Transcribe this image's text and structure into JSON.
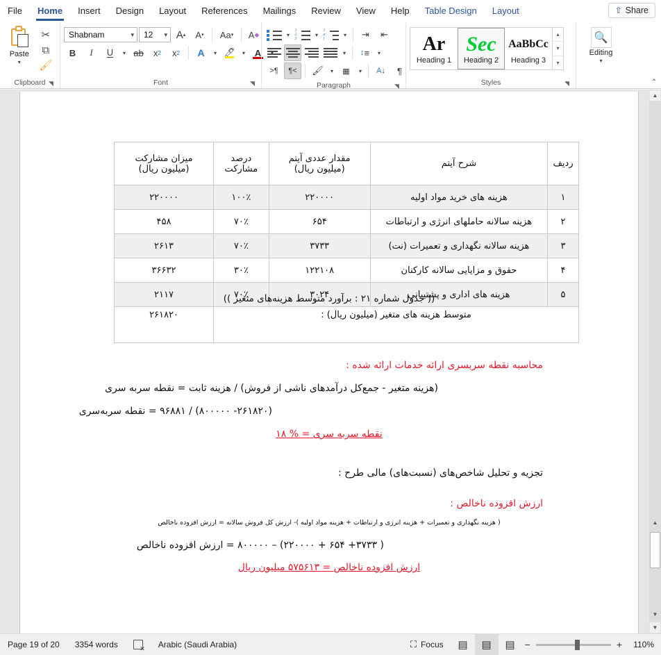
{
  "tabs": [
    {
      "label": "File",
      "state": "normal"
    },
    {
      "label": "Home",
      "state": "active"
    },
    {
      "label": "Insert",
      "state": "normal"
    },
    {
      "label": "Design",
      "state": "normal"
    },
    {
      "label": "Layout",
      "state": "normal"
    },
    {
      "label": "References",
      "state": "normal"
    },
    {
      "label": "Mailings",
      "state": "normal"
    },
    {
      "label": "Review",
      "state": "normal"
    },
    {
      "label": "View",
      "state": "normal"
    },
    {
      "label": "Help",
      "state": "normal"
    },
    {
      "label": "Table Design",
      "state": "contextual"
    },
    {
      "label": "Layout",
      "state": "contextual"
    }
  ],
  "share": {
    "label": "Share",
    "icon": "share-icon"
  },
  "ribbon": {
    "clipboard": {
      "label": "Clipboard",
      "paste_label": "Paste",
      "cut_icon": "scissors-icon",
      "copy_icon": "copy-icon",
      "format_painter_icon": "format-painter-icon"
    },
    "font": {
      "label": "Font",
      "font_name": "Shabnam",
      "font_size": "12",
      "grow_font_icon": "grow-font-icon",
      "shrink_font_icon": "shrink-font-icon",
      "change_case_icon": "change-case-icon",
      "clear_formatting_icon": "clear-formatting-icon",
      "bold": "B",
      "italic": "I",
      "underline": "U",
      "strikethrough_icon": "strikethrough-icon",
      "subscript_icon": "subscript-icon",
      "superscript_icon": "superscript-icon",
      "text_effects_icon": "text-effects-icon",
      "highlight_icon": "text-highlight-icon",
      "font_color_icon": "font-color-icon",
      "font_color_hex": "#cc0000",
      "highlight_hex": "#ffe600"
    },
    "paragraph": {
      "label": "Paragraph",
      "bullets_icon": "bullets-icon",
      "numbering_icon": "numbering-icon",
      "multilevel_icon": "multilevel-list-icon",
      "decrease_indent_icon": "decrease-indent-icon",
      "increase_indent_icon": "increase-indent-icon",
      "align_left_icon": "align-left-icon",
      "align_center_icon": "align-center-icon",
      "align_right_icon": "align-right-icon",
      "justify_icon": "justify-icon",
      "line_spacing_icon": "line-spacing-icon",
      "ltr_icon": "left-to-right-icon",
      "rtl_icon": "right-to-left-icon",
      "shading_icon": "shading-icon",
      "borders_icon": "borders-icon",
      "sort_icon": "sort-icon",
      "show_marks_icon": "show-formatting-marks-icon"
    },
    "styles": {
      "label": "Styles",
      "items": [
        {
          "preview": "Ar",
          "name": "Heading 1",
          "selected": false
        },
        {
          "preview": "Sec",
          "name": "Heading 2",
          "selected": true
        },
        {
          "preview": "AaBbCc",
          "name": "Heading 3",
          "selected": false
        }
      ]
    },
    "editing": {
      "label": "Editing",
      "icon": "search-icon"
    }
  },
  "document": {
    "table": {
      "headers": [
        "ردیف",
        "شرح آیتم",
        "مقدار عددی آیتم\n(میلیون ریال)",
        "درصد\nمشارکت",
        "میزان مشارکت\n(میلیون ریال)"
      ],
      "header_lines": [
        {
          "l1": "ردیف",
          "l2": ""
        },
        {
          "l1": "شرح آیتم",
          "l2": ""
        },
        {
          "l1": "مقدار عددی آیتم",
          "l2": "(میلیون ریال)"
        },
        {
          "l1": "درصد",
          "l2": "مشارکت"
        },
        {
          "l1": "میزان مشارکت",
          "l2": "(میلیون ریال)"
        }
      ],
      "rows": [
        {
          "radif": "۱",
          "desc": "هزینه های خرید مواد اولیه",
          "value": "۲۲۰۰۰۰",
          "percent": "۱۰۰٪",
          "share": "۲۲۰۰۰۰"
        },
        {
          "radif": "۲",
          "desc": "هزینه سالانه حاملهای انرژی و ارتباطات",
          "value": "۶۵۴",
          "percent": "۷۰٪",
          "share": "۴۵۸"
        },
        {
          "radif": "۳",
          "desc": "هزینه سالانه نگهداری و تعمیرات (نت)",
          "value": "۳۷۳۳",
          "percent": "۷۰٪",
          "share": "۲۶۱۳"
        },
        {
          "radif": "۴",
          "desc": "حقوق و مزایایی سالانه کارکنان",
          "value": "۱۲۲۱۰۸",
          "percent": "۳۰٪",
          "share": "۳۶۶۳۲"
        },
        {
          "radif": "۵",
          "desc": "هزینه های اداری و پشتیبانی",
          "value": "۳۰۲۴",
          "percent": "۷۰٪",
          "share": "۲۱۱۷"
        }
      ],
      "total_label": "متوسط هزینه های متغیر (میلیون ریال) :",
      "total_value": "۲۶۱۸۲۰"
    },
    "caption": "(( جدول شماره ۲۱ : برآورد متوسط هزینه‌های متغیر ))",
    "paragraphs": [
      {
        "text": "محاسبه نقطه سربسری ارائه خدمات ارائه شده :",
        "style": "red"
      },
      {
        "text": "(هزینه متغیر  -  جمع‌کل درآمدهای ناشی از فروش) / هزینه ثابت = نقطه سربه سری",
        "style": "normal"
      },
      {
        "text": "(۲۶۱۸۲۰-  ۸۰۰۰۰۰) / ۹۶۸۸۱ = نقطه سربه‌سری",
        "style": "normal"
      },
      {
        "text": "نقطه سربه سری = % ۱۸",
        "style": "red-underline"
      },
      {
        "text": "تجزیه و تحلیل شاخص‌های (نسبت‌های) مالی طرح :",
        "style": "normal"
      },
      {
        "text": "ارزش افزوده ناخالص :",
        "style": "red"
      },
      {
        "text": "( هزینه نگهداری و تعمیرات + هزینه انرژی و ارتباطات + هزینه مواد اولیه )- ارزش کل فروش سالانه  = ارزش افزوده ناخالص",
        "style": "tiny"
      },
      {
        "text": "( ۳۷۳۳+ ۶۵۴ + ۲۲۰۰۰۰) – ۸۰۰۰۰۰ = ارزش افزوده ناخالص",
        "style": "normal"
      },
      {
        "text": "ارزش افزوده ناخالص = ۵۷۵۶۱۳  میلیون ریال",
        "style": "red-underline"
      }
    ]
  },
  "statusbar": {
    "page": "Page 19 of 20",
    "words": "3354 words",
    "proofing_icon": "proofing-errors-icon",
    "language": "Arabic (Saudi Arabia)",
    "focus": "Focus",
    "focus_icon": "focus-icon",
    "read_mode_icon": "read-mode-icon",
    "print_layout_icon": "print-layout-icon",
    "web_layout_icon": "web-layout-icon",
    "zoom_out_icon": "zoom-out-icon",
    "zoom_in_icon": "zoom-in-icon",
    "zoom": "110%"
  }
}
